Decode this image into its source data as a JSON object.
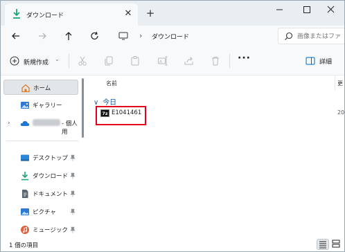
{
  "window": {
    "tab_title": "ダウンロード",
    "tab_close_glyph": "✕",
    "new_tab_glyph": "+"
  },
  "address": {
    "separator": "›",
    "location": "ダウンロード"
  },
  "search": {
    "placeholder": "画像またはファ"
  },
  "toolbar": {
    "new_label": "新規作成",
    "new_caret": "⌄",
    "more_label": "···",
    "details_label": "詳細"
  },
  "navigation": {
    "items": [
      {
        "label": "ホーム",
        "icon": "home-icon",
        "selected": true
      },
      {
        "label": "ギャラリー",
        "icon": "gallery-icon"
      },
      {
        "label": "- 個人用",
        "icon": "onedrive-icon",
        "expander": "›"
      },
      {
        "label": "デスクトップ",
        "icon": "desktop-icon",
        "pinned": true
      },
      {
        "label": "ダウンロード",
        "icon": "download-icon",
        "pinned": true
      },
      {
        "label": "ドキュメント",
        "icon": "documents-icon",
        "pinned": true
      },
      {
        "label": "ピクチャ",
        "icon": "pictures-icon",
        "pinned": true
      },
      {
        "label": "ミュージック",
        "icon": "music-icon",
        "pinned": true
      }
    ]
  },
  "content": {
    "column_name": "名前",
    "column_date": "更",
    "group_chevron": "∨",
    "group_label": "今日",
    "files": [
      {
        "icon_text": "7z",
        "name": "E1041461",
        "date": "20"
      }
    ]
  },
  "status": {
    "item_count": "1 個の項目"
  },
  "colors": {
    "accent": "#0067c0",
    "highlight_border": "#e0001b",
    "download_green": "#1aa37a"
  }
}
